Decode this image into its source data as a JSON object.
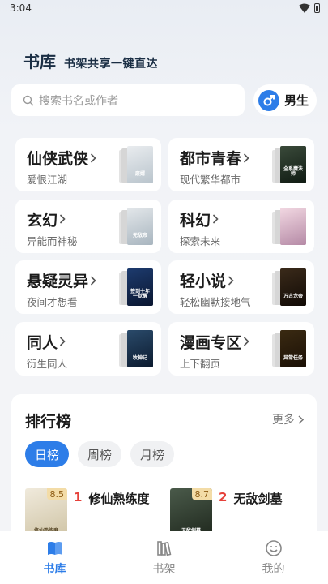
{
  "status": {
    "time": "3:04"
  },
  "header": {
    "title": "书库",
    "slogan": "书架共享一键直达"
  },
  "search": {
    "placeholder": "搜索书名或作者"
  },
  "gender": {
    "label": "男生",
    "icon": "male-icon",
    "accent": "#2d7de8"
  },
  "categories": [
    {
      "title": "仙侠武侠",
      "subtitle": "爱恨江湖",
      "cover_text": "废婿"
    },
    {
      "title": "都市青春",
      "subtitle": "现代繁华都市",
      "cover_text": "全系魔法师"
    },
    {
      "title": "玄幻",
      "subtitle": "异能而神秘",
      "cover_text": "无敌帝"
    },
    {
      "title": "科幻",
      "subtitle": "探索未来",
      "cover_text": ""
    },
    {
      "title": "悬疑灵异",
      "subtitle": "夜间才想看",
      "cover_text": "签到十年一觉醒"
    },
    {
      "title": "轻小说",
      "subtitle": "轻松幽默接地气",
      "cover_text": "万古龙帝"
    },
    {
      "title": "同人",
      "subtitle": "衍生同人",
      "cover_text": "牧神记"
    },
    {
      "title": "漫画专区",
      "subtitle": "上下翻页",
      "cover_text": "异常任务"
    }
  ],
  "ranking": {
    "title": "排行榜",
    "more": "更多",
    "tabs": [
      {
        "label": "日榜",
        "active": true
      },
      {
        "label": "周榜",
        "active": false
      },
      {
        "label": "月榜",
        "active": false
      }
    ],
    "items": [
      {
        "rank": "1",
        "name": "修仙熟练度",
        "score": "8.5",
        "cover_text": "修仙熟练度"
      },
      {
        "rank": "2",
        "name": "无敌剑墓",
        "score": "8.7",
        "cover_text": "无敌剑墓"
      }
    ]
  },
  "nav": [
    {
      "label": "书库",
      "icon": "book-open-icon",
      "active": true
    },
    {
      "label": "书架",
      "icon": "bookshelf-icon",
      "active": false
    },
    {
      "label": "我的",
      "icon": "smile-icon",
      "active": false
    }
  ],
  "colors": {
    "accent": "#2d7de8",
    "rank_number": "#e6413a",
    "score_bg": "#f3dca7"
  }
}
